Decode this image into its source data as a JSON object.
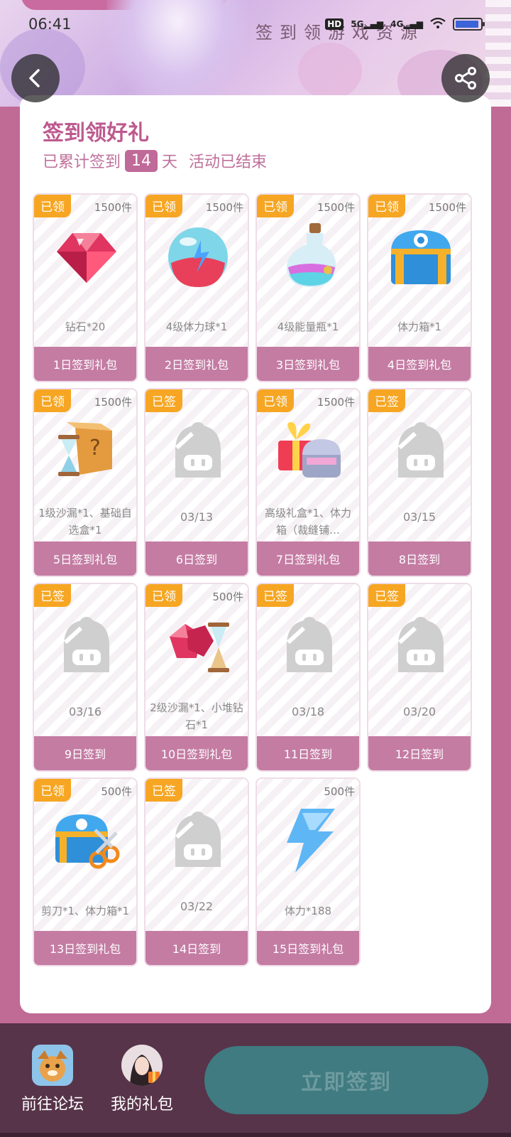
{
  "status_bar": {
    "time": "06:41",
    "hd": "HD",
    "net5g": "5G",
    "net4g": "4G"
  },
  "hero": {
    "title": "签到领游戏资源"
  },
  "panel": {
    "title": "签到领好礼",
    "prefix": "已累计签到",
    "days": "14",
    "days_suffix": "天",
    "status": "活动已结束"
  },
  "cards": [
    {
      "badge": "已领",
      "qty": "1500件",
      "desc": "钻石*20",
      "date": "",
      "foot": "1日签到礼包",
      "art": "gem"
    },
    {
      "badge": "已领",
      "qty": "1500件",
      "desc": "4级体力球*1",
      "date": "",
      "foot": "2日签到礼包",
      "art": "orb"
    },
    {
      "badge": "已领",
      "qty": "1500件",
      "desc": "4级能量瓶*1",
      "date": "",
      "foot": "3日签到礼包",
      "art": "potion"
    },
    {
      "badge": "已领",
      "qty": "1500件",
      "desc": "体力箱*1",
      "date": "",
      "foot": "4日签到礼包",
      "art": "chest"
    },
    {
      "badge": "已领",
      "qty": "1500件",
      "desc": "1级沙漏*1、基础自选盒*1",
      "date": "",
      "foot": "5日签到礼包",
      "art": "box"
    },
    {
      "badge": "已签",
      "qty": "",
      "desc": "",
      "date": "03/13",
      "foot": "6日签到",
      "art": "placeholder"
    },
    {
      "badge": "已领",
      "qty": "1500件",
      "desc": "高级礼盒*1、体力箱（裁缝铺…",
      "date": "",
      "foot": "7日签到礼包",
      "art": "gift"
    },
    {
      "badge": "已签",
      "qty": "",
      "desc": "",
      "date": "03/15",
      "foot": "8日签到",
      "art": "placeholder"
    },
    {
      "badge": "已签",
      "qty": "",
      "desc": "",
      "date": "03/16",
      "foot": "9日签到",
      "art": "placeholder"
    },
    {
      "badge": "已领",
      "qty": "500件",
      "desc": "2级沙漏*1、小堆钻石*1",
      "date": "",
      "foot": "10日签到礼包",
      "art": "gems"
    },
    {
      "badge": "已签",
      "qty": "",
      "desc": "",
      "date": "03/18",
      "foot": "11日签到",
      "art": "placeholder"
    },
    {
      "badge": "已签",
      "qty": "",
      "desc": "",
      "date": "03/20",
      "foot": "12日签到",
      "art": "placeholder"
    },
    {
      "badge": "已领",
      "qty": "500件",
      "desc": "剪刀*1、体力箱*1",
      "date": "",
      "foot": "13日签到礼包",
      "art": "chest2"
    },
    {
      "badge": "已签",
      "qty": "",
      "desc": "",
      "date": "03/22",
      "foot": "14日签到",
      "art": "placeholder"
    },
    {
      "badge": "",
      "qty": "500件",
      "desc": "体力*188",
      "date": "",
      "foot": "15日签到礼包",
      "art": "bolt"
    }
  ],
  "bottom_bar": {
    "forum_label": "前往论坛",
    "gift_label": "我的礼包",
    "cta_label": "立即签到"
  },
  "colors": {
    "accent": "#bd5a8e",
    "badge": "#f6a623",
    "cta": "#3f7b80",
    "bottom_bg": "#57344a"
  }
}
